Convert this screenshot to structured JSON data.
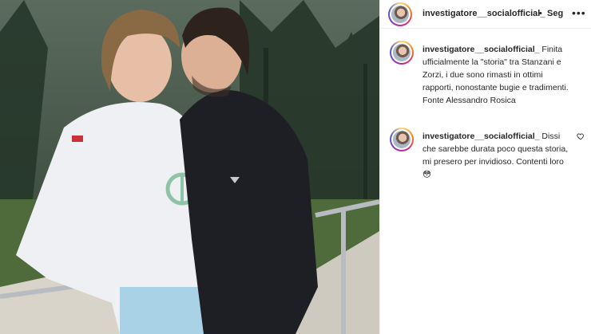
{
  "post": {
    "username": "investigatore__socialofficial_",
    "separator": "•",
    "follow_label": "Seg",
    "more_icon": "more-horizontal-icon"
  },
  "comments": [
    {
      "username": "investigatore__socialofficial_",
      "text": "Finita ufficialmente la \"storia\" tra Stanzani e Zorzi, i due sono rimasti in ottimi rapporti, nonostante bugie e tradimenti. Fonte Alessandro Rosica"
    },
    {
      "username": "investigatore__socialofficial_",
      "text": "Dissi che sarebbe durata poco questa storia, mi presero per invidioso. Contenti loro 😳",
      "like_icon": "heart-icon"
    }
  ],
  "colors": {
    "text": "#262626",
    "border": "#efefef",
    "avatar_ring": [
      "#feda75",
      "#fa7e1e",
      "#d62976",
      "#962fbf",
      "#4f5bd5"
    ]
  }
}
